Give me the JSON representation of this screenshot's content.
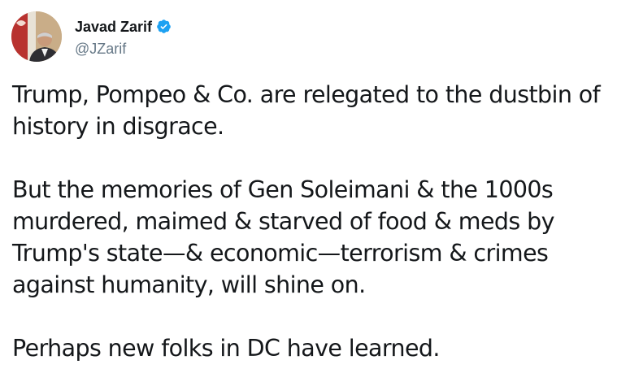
{
  "tweet": {
    "author": {
      "display_name": "Javad Zarif",
      "handle": "@JZarif",
      "verified": true,
      "avatar_icon": "profile-photo",
      "verified_icon": "verified-badge-icon",
      "verified_color": "#1da1f2"
    },
    "body": {
      "paragraphs": [
        {
          "lines": [
            "Trump, Pompeo & Co. are relegated to the dustbin of",
            "history in disgrace."
          ]
        },
        {
          "lines": [
            "But the memories of Gen Soleimani & the 1000s",
            "murdered, maimed & starved of food & meds by",
            "Trump's state—& economic—terrorism & crimes",
            "against humanity, will shine on."
          ]
        },
        {
          "lines": [
            "Perhaps new folks in DC have learned."
          ]
        }
      ]
    }
  }
}
